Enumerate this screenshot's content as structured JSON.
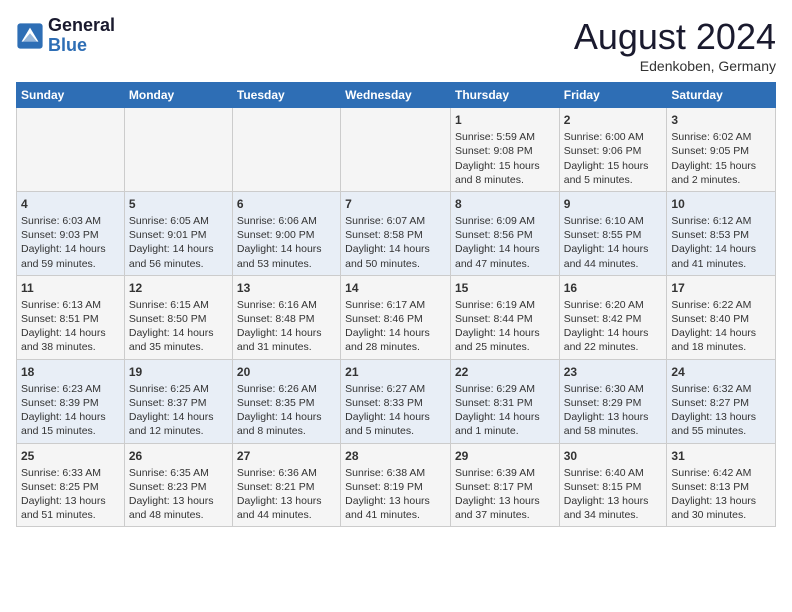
{
  "header": {
    "logo_line1": "General",
    "logo_line2": "Blue",
    "month_year": "August 2024",
    "location": "Edenkoben, Germany"
  },
  "weekdays": [
    "Sunday",
    "Monday",
    "Tuesday",
    "Wednesday",
    "Thursday",
    "Friday",
    "Saturday"
  ],
  "weeks": [
    [
      {
        "day": "",
        "info": ""
      },
      {
        "day": "",
        "info": ""
      },
      {
        "day": "",
        "info": ""
      },
      {
        "day": "",
        "info": ""
      },
      {
        "day": "1",
        "info": "Sunrise: 5:59 AM\nSunset: 9:08 PM\nDaylight: 15 hours and 8 minutes."
      },
      {
        "day": "2",
        "info": "Sunrise: 6:00 AM\nSunset: 9:06 PM\nDaylight: 15 hours and 5 minutes."
      },
      {
        "day": "3",
        "info": "Sunrise: 6:02 AM\nSunset: 9:05 PM\nDaylight: 15 hours and 2 minutes."
      }
    ],
    [
      {
        "day": "4",
        "info": "Sunrise: 6:03 AM\nSunset: 9:03 PM\nDaylight: 14 hours and 59 minutes."
      },
      {
        "day": "5",
        "info": "Sunrise: 6:05 AM\nSunset: 9:01 PM\nDaylight: 14 hours and 56 minutes."
      },
      {
        "day": "6",
        "info": "Sunrise: 6:06 AM\nSunset: 9:00 PM\nDaylight: 14 hours and 53 minutes."
      },
      {
        "day": "7",
        "info": "Sunrise: 6:07 AM\nSunset: 8:58 PM\nDaylight: 14 hours and 50 minutes."
      },
      {
        "day": "8",
        "info": "Sunrise: 6:09 AM\nSunset: 8:56 PM\nDaylight: 14 hours and 47 minutes."
      },
      {
        "day": "9",
        "info": "Sunrise: 6:10 AM\nSunset: 8:55 PM\nDaylight: 14 hours and 44 minutes."
      },
      {
        "day": "10",
        "info": "Sunrise: 6:12 AM\nSunset: 8:53 PM\nDaylight: 14 hours and 41 minutes."
      }
    ],
    [
      {
        "day": "11",
        "info": "Sunrise: 6:13 AM\nSunset: 8:51 PM\nDaylight: 14 hours and 38 minutes."
      },
      {
        "day": "12",
        "info": "Sunrise: 6:15 AM\nSunset: 8:50 PM\nDaylight: 14 hours and 35 minutes."
      },
      {
        "day": "13",
        "info": "Sunrise: 6:16 AM\nSunset: 8:48 PM\nDaylight: 14 hours and 31 minutes."
      },
      {
        "day": "14",
        "info": "Sunrise: 6:17 AM\nSunset: 8:46 PM\nDaylight: 14 hours and 28 minutes."
      },
      {
        "day": "15",
        "info": "Sunrise: 6:19 AM\nSunset: 8:44 PM\nDaylight: 14 hours and 25 minutes."
      },
      {
        "day": "16",
        "info": "Sunrise: 6:20 AM\nSunset: 8:42 PM\nDaylight: 14 hours and 22 minutes."
      },
      {
        "day": "17",
        "info": "Sunrise: 6:22 AM\nSunset: 8:40 PM\nDaylight: 14 hours and 18 minutes."
      }
    ],
    [
      {
        "day": "18",
        "info": "Sunrise: 6:23 AM\nSunset: 8:39 PM\nDaylight: 14 hours and 15 minutes."
      },
      {
        "day": "19",
        "info": "Sunrise: 6:25 AM\nSunset: 8:37 PM\nDaylight: 14 hours and 12 minutes."
      },
      {
        "day": "20",
        "info": "Sunrise: 6:26 AM\nSunset: 8:35 PM\nDaylight: 14 hours and 8 minutes."
      },
      {
        "day": "21",
        "info": "Sunrise: 6:27 AM\nSunset: 8:33 PM\nDaylight: 14 hours and 5 minutes."
      },
      {
        "day": "22",
        "info": "Sunrise: 6:29 AM\nSunset: 8:31 PM\nDaylight: 14 hours and 1 minute."
      },
      {
        "day": "23",
        "info": "Sunrise: 6:30 AM\nSunset: 8:29 PM\nDaylight: 13 hours and 58 minutes."
      },
      {
        "day": "24",
        "info": "Sunrise: 6:32 AM\nSunset: 8:27 PM\nDaylight: 13 hours and 55 minutes."
      }
    ],
    [
      {
        "day": "25",
        "info": "Sunrise: 6:33 AM\nSunset: 8:25 PM\nDaylight: 13 hours and 51 minutes."
      },
      {
        "day": "26",
        "info": "Sunrise: 6:35 AM\nSunset: 8:23 PM\nDaylight: 13 hours and 48 minutes."
      },
      {
        "day": "27",
        "info": "Sunrise: 6:36 AM\nSunset: 8:21 PM\nDaylight: 13 hours and 44 minutes."
      },
      {
        "day": "28",
        "info": "Sunrise: 6:38 AM\nSunset: 8:19 PM\nDaylight: 13 hours and 41 minutes."
      },
      {
        "day": "29",
        "info": "Sunrise: 6:39 AM\nSunset: 8:17 PM\nDaylight: 13 hours and 37 minutes."
      },
      {
        "day": "30",
        "info": "Sunrise: 6:40 AM\nSunset: 8:15 PM\nDaylight: 13 hours and 34 minutes."
      },
      {
        "day": "31",
        "info": "Sunrise: 6:42 AM\nSunset: 8:13 PM\nDaylight: 13 hours and 30 minutes."
      }
    ]
  ]
}
